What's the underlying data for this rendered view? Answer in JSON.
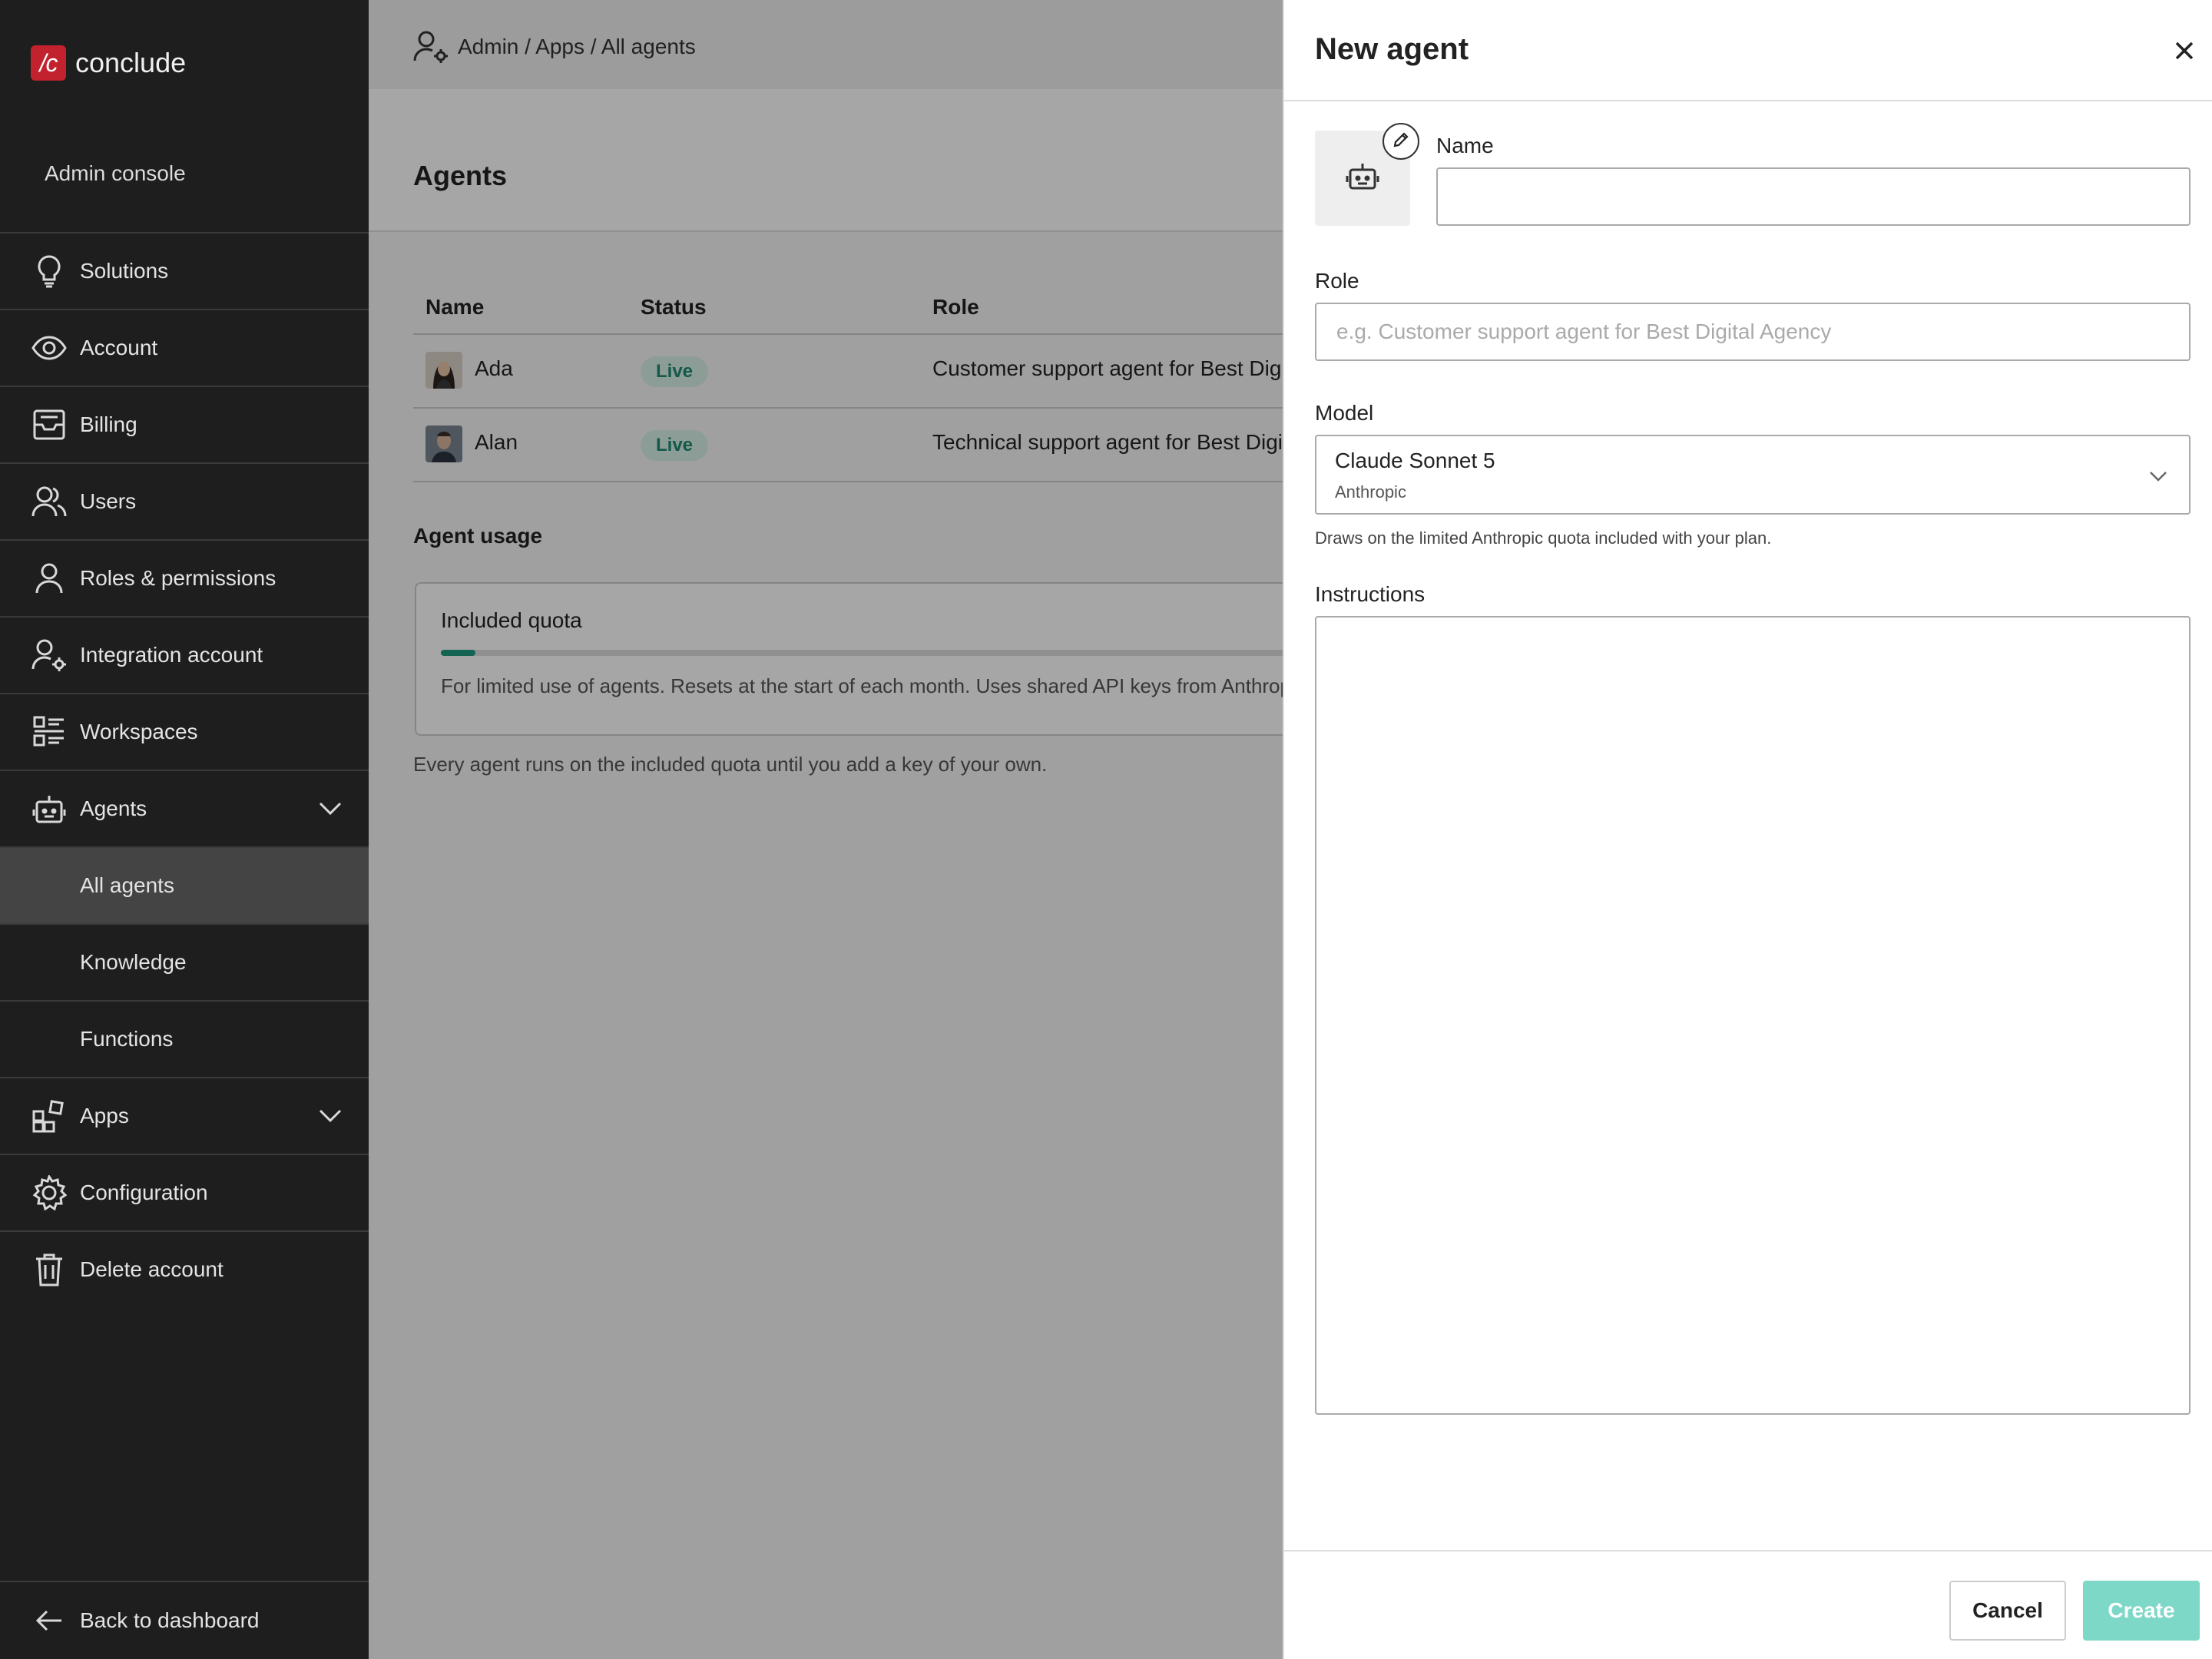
{
  "app": {
    "logo_mark": "/c",
    "logo_text": "conclude",
    "console_label": "Admin console"
  },
  "sidebar": {
    "items": [
      {
        "label": "Solutions",
        "icon": "lightbulb-icon"
      },
      {
        "label": "Account",
        "icon": "eye-icon"
      },
      {
        "label": "Billing",
        "icon": "inbox-icon"
      },
      {
        "label": "Users",
        "icon": "users-icon"
      },
      {
        "label": "Roles & permissions",
        "icon": "user-icon"
      },
      {
        "label": "Integration account",
        "icon": "user-gear-icon"
      },
      {
        "label": "Workspaces",
        "icon": "list-icon"
      },
      {
        "label": "Agents",
        "icon": "robot-icon",
        "expanded": true
      },
      {
        "label": "All agents",
        "sub": true,
        "active": true
      },
      {
        "label": "Knowledge",
        "sub": true
      },
      {
        "label": "Functions",
        "sub": true
      },
      {
        "label": "Apps",
        "icon": "apps-icon",
        "expanded": false
      },
      {
        "label": "Configuration",
        "icon": "gear-icon"
      },
      {
        "label": "Delete account",
        "icon": "trash-icon"
      }
    ],
    "back_label": "Back to dashboard"
  },
  "breadcrumb": "Admin / Apps / All agents",
  "page": {
    "title": "Agents",
    "columns": [
      "Name",
      "Status",
      "Role"
    ],
    "rows": [
      {
        "name": "Ada",
        "status": "Live",
        "role": "Customer support agent for Best Digital Agency"
      },
      {
        "name": "Alan",
        "status": "Live",
        "role": "Technical support agent for Best Digital Agency"
      }
    ],
    "usage_title": "Agent usage",
    "quota": {
      "title": "Included quota",
      "used_fraction": 0.03,
      "description": "For limited use of agents. Resets at the start of each month. Uses shared API keys from Anthropic."
    },
    "usage_note": "Every agent runs on the included quota until you add a key of your own."
  },
  "drawer": {
    "title": "New agent",
    "name_label": "Name",
    "name_value": "",
    "role_label": "Role",
    "role_placeholder": "e.g. Customer support agent for Best Digital Agency",
    "model_label": "Model",
    "model_value": "Claude Sonnet 5",
    "model_provider": "Anthropic",
    "model_hint": "Draws on the limited Anthropic quota included with your plan.",
    "instructions_label": "Instructions",
    "instructions_value": "",
    "cancel_label": "Cancel",
    "create_label": "Create"
  },
  "colors": {
    "accent": "#1f9a80",
    "brand": "#c2212e",
    "create_disabled": "#7dd8c8",
    "sidebar_bg": "#1e1e1e"
  }
}
